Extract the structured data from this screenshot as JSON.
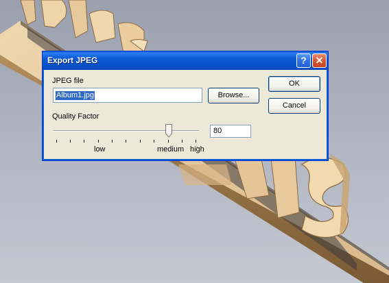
{
  "dialog": {
    "title": "Export JPEG",
    "help_glyph": "?",
    "close_glyph": "✕",
    "file_label": "JPEG file",
    "file_value": "Album1.jpg",
    "browse_label": "Browse...",
    "ok_label": "OK",
    "cancel_label": "Cancel",
    "quality_label": "Quality Factor",
    "quality_value": "80",
    "slider_level": 0.8,
    "tick_labels": {
      "low": "low",
      "medium": "medium",
      "high": "high"
    }
  },
  "colors": {
    "titlebar": "#0a58d2",
    "dialog_bg": "#ece9d8",
    "selection": "#316ac5",
    "close_button": "#d45a34",
    "background_object": "#d9b98c"
  }
}
